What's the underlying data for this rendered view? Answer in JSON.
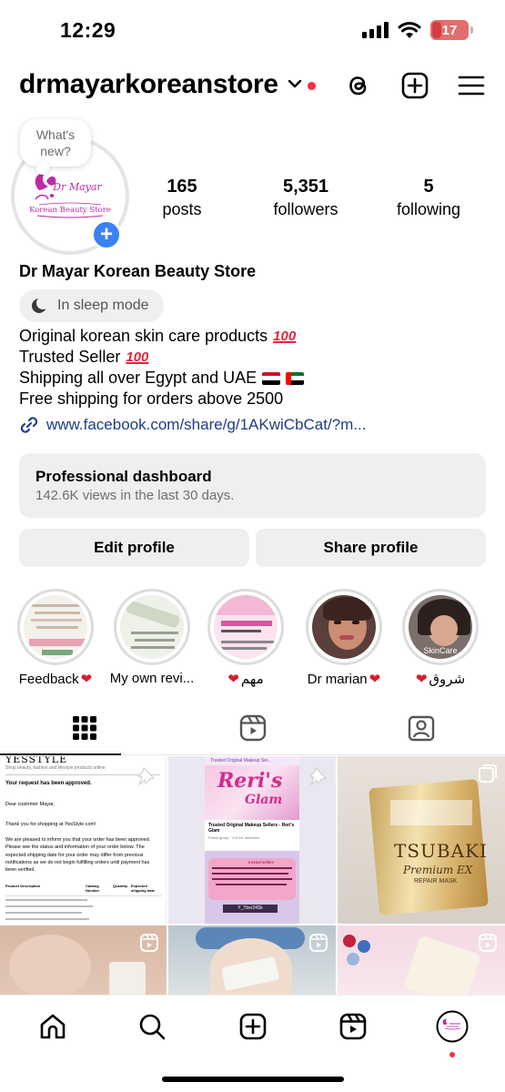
{
  "status_bar": {
    "time": "12:29",
    "battery": "17"
  },
  "header": {
    "username": "drmayarkoreanstore",
    "icons": [
      "chevron-down-icon",
      "threads-icon",
      "plus-square-icon",
      "menu-icon"
    ]
  },
  "profile": {
    "note": "What's new?",
    "avatar_text_line1": "Dr Mayar",
    "avatar_text_line2": "Korean Beauty Store",
    "stats": [
      {
        "value": "165",
        "label": "posts"
      },
      {
        "value": "5,351",
        "label": "followers"
      },
      {
        "value": "5",
        "label": "following"
      }
    ],
    "display_name": "Dr Mayar Korean Beauty Store",
    "sleep_mode": "In sleep mode",
    "bio": {
      "line1": "Original korean skin care products",
      "line2": "Trusted Seller",
      "line3": "Shipping all over Egypt and UAE",
      "line4": "Free shipping for orders above 2500"
    },
    "link": "www.facebook.com/share/g/1AKwiCbCat/?m..."
  },
  "dashboard": {
    "title": "Professional dashboard",
    "subtitle": "142.6K views in the last 30 days."
  },
  "actions": {
    "edit": "Edit profile",
    "share": "Share profile"
  },
  "highlights": [
    {
      "label": "Feedback"
    },
    {
      "label": "My own revi..."
    },
    {
      "label": "مهم"
    },
    {
      "label": "Dr marian"
    },
    {
      "label": "شروق",
      "cover_text": "SkinCare"
    }
  ],
  "tabs": [
    "grid-icon",
    "reels-icon",
    "tagged-icon"
  ],
  "grid": {
    "tile1": {
      "brand": "YESSTYLE",
      "tagline": "Shop beauty, fashion and lifestyle products online",
      "heading": "Your request has been approved.",
      "greeting": "Dear customer Mayar,",
      "thanks": "Thank you for shopping at YesStyle.com!",
      "body": "We are pleased to inform you that your order has been approved. Please see the status and information of your order below. The expected shipping date for your order may differ from previous notifications as we do not begin fulfilling orders until payment has been verified.",
      "col1": "Product Description",
      "col2": "Catalog Number",
      "col3": "Quantity",
      "col4": "Expected shipping date"
    },
    "tile2": {
      "bar": "Trusted Original Makeup Sel...",
      "logo_top": "Reri's",
      "logo_bottom": "Glam",
      "group_title": "Trusted Original Makeup Sellers - Reri's Glam",
      "members": "Public group · 413.1K members",
      "sellers_tag": "trusted sellers",
      "seller": "Y_Tbsr24Sk"
    },
    "tile3": {
      "brand": "TSUBAKI",
      "product": "Premium EX",
      "sub": "REPAIR MASK"
    }
  },
  "bottom_nav": [
    "home-icon",
    "search-icon",
    "create-icon",
    "reels-icon",
    "profile-avatar"
  ],
  "colors": {
    "accent_blue": "#3b82f6",
    "link": "#1e3b8a",
    "notification": "#ff2d3d",
    "heart": "#d81d2c",
    "gray_button": "#efefef"
  }
}
